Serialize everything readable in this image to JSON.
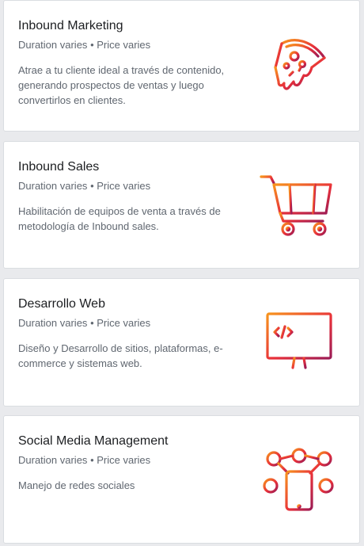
{
  "services": [
    {
      "title": "Inbound Marketing",
      "duration": "Duration varies",
      "separator": "•",
      "price": "Price varies",
      "description": "Atrae a tu cliente ideal a través de contenido, generando prospectos de ventas y luego convertirlos en clientes.",
      "icon": "pizza-slice-icon"
    },
    {
      "title": "Inbound Sales",
      "duration": "Duration varies",
      "separator": "•",
      "price": "Price varies",
      "description": "Habilitación de equipos de venta a través de metodología de Inbound sales.",
      "icon": "shopping-cart-icon"
    },
    {
      "title": "Desarrollo Web",
      "duration": "Duration varies",
      "separator": "•",
      "price": "Price varies",
      "description": "Diseño y Desarrollo de sitios, plataformas, e-commerce y sistemas web.",
      "icon": "monitor-code-icon"
    },
    {
      "title": "Social Media Management",
      "duration": "Duration varies",
      "separator": "•",
      "price": "Price varies",
      "description": "Manejo de redes sociales",
      "icon": "social-network-phone-icon"
    }
  ],
  "colors": {
    "page_background": "#e9eaed",
    "card_background": "#ffffff",
    "title_text": "#1c1e21",
    "secondary_text": "#606770",
    "icon_gradient_start": "#f7941d",
    "icon_gradient_mid": "#e8303a",
    "icon_gradient_end": "#9b1b55"
  }
}
